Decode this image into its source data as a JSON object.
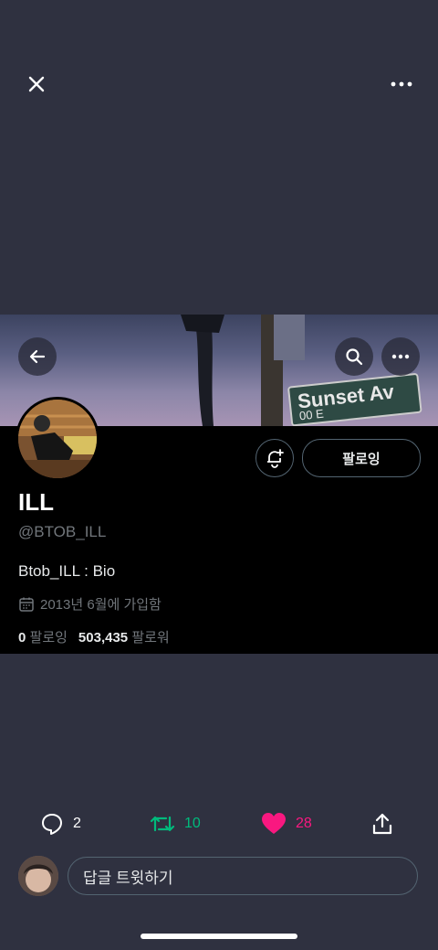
{
  "viewer": {
    "close_icon": "close-icon",
    "more_icon": "more-horizontal-icon"
  },
  "banner": {
    "sign_text": "Sunset Av",
    "sign_sub": "00 E"
  },
  "profile": {
    "display_name": "ILL",
    "handle": "@BTOB_ILL",
    "bio": "Btob_ILL : Bio",
    "joined": "2013년 6월에 가입함",
    "following_count": "0",
    "following_label": "팔로잉",
    "followers_count": "503,435",
    "followers_label": "팔로워",
    "follow_button": "팔로잉"
  },
  "actions": {
    "replies": "2",
    "retweets": "10",
    "likes": "28",
    "colors": {
      "retweet": "#00ba7c",
      "like": "#f91880"
    }
  },
  "reply_bar": {
    "placeholder": "답글 트윗하기"
  }
}
